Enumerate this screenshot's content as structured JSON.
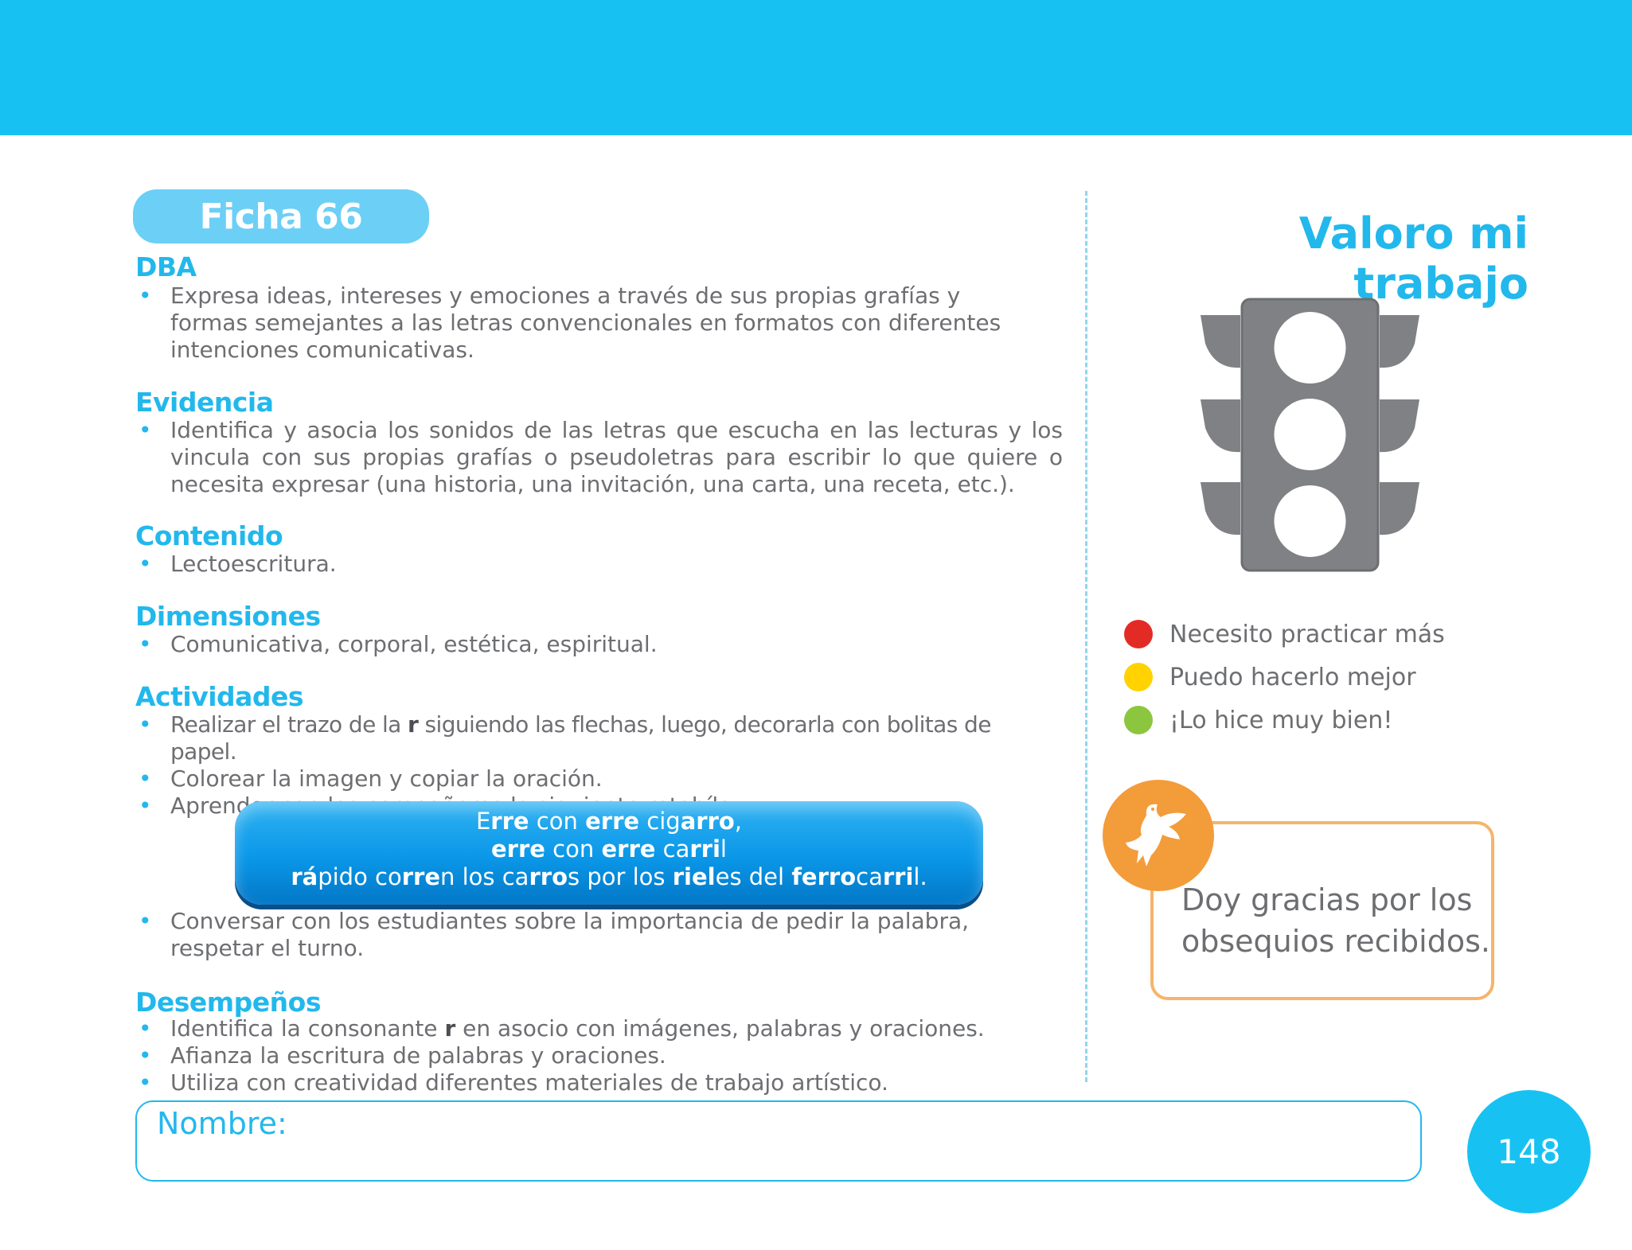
{
  "header": {
    "band_color": "#17c2f2"
  },
  "ficha": {
    "label": "Ficha 66"
  },
  "sections": {
    "dba": {
      "title": "DBA",
      "items": [
        "Expresa ideas, intereses y emociones a través de sus propias grafías y formas semejantes a las letras convencionales en formatos con diferentes intenciones comunicativas."
      ]
    },
    "evidencia": {
      "title": "Evidencia",
      "items": [
        "Identifica y asocia los sonidos de las letras que escucha en las lecturas y los vincula con sus propias grafías o pseudoletras para escribir lo que quiere o necesita expresar (una historia, una invitación, una carta, una receta, etc.)."
      ]
    },
    "contenido": {
      "title": "Contenido",
      "items": [
        "Lectoescritura."
      ]
    },
    "dimensiones": {
      "title": "Dimensiones",
      "items": [
        "Comunicativa, corporal, estética, espiritual."
      ]
    },
    "actividades": {
      "title": "Actividades",
      "item1_a": "Realizar el trazo de la ",
      "item1_r": "r",
      "item1_b": " siguiendo las flechas, luego, decorarla con bolitas de papel.",
      "item2": "Colorear la imagen y copiar la oración.",
      "item3": "Aprender con los compañeros la siguiente retahíla:",
      "item4": "Conversar con los estudiantes sobre la importancia de pedir la palabra, respetar el turno."
    },
    "desempenos": {
      "title": "Desempeños",
      "item1_a": "Identifica la consonante ",
      "item1_r": "r",
      "item1_b": " en asocio con imágenes, palabras y oraciones.",
      "item2": "Afianza la escritura de palabras y oraciones.",
      "item3": "Utiliza con creatividad diferentes materiales de trabajo artístico."
    }
  },
  "retahila": {
    "l1": [
      "E",
      "rre",
      " con ",
      "erre",
      " cig",
      "arro",
      ","
    ],
    "l2": [
      "erre",
      " con ",
      "erre",
      " ca",
      "rri",
      "l"
    ],
    "l3": [
      "rá",
      "pido co",
      "rre",
      "n los ca",
      "rro",
      "s por los ",
      "riel",
      "es del ",
      "ferro",
      "ca",
      "rri",
      "l."
    ]
  },
  "valoro": {
    "title": "Valoro mi trabajo",
    "legend": [
      {
        "label": "Necesito practicar más",
        "color": "#e32b26"
      },
      {
        "label": "Puedo hacerlo mejor",
        "color": "#ffd200"
      },
      {
        "label": "¡Lo hice muy bien!",
        "color": "#8cc63f"
      }
    ],
    "value_text": "Doy gracias por los obsequios recibidos.",
    "value_icon": "dove-icon"
  },
  "footer": {
    "name_label": "Nombre:",
    "page_number": "148"
  }
}
